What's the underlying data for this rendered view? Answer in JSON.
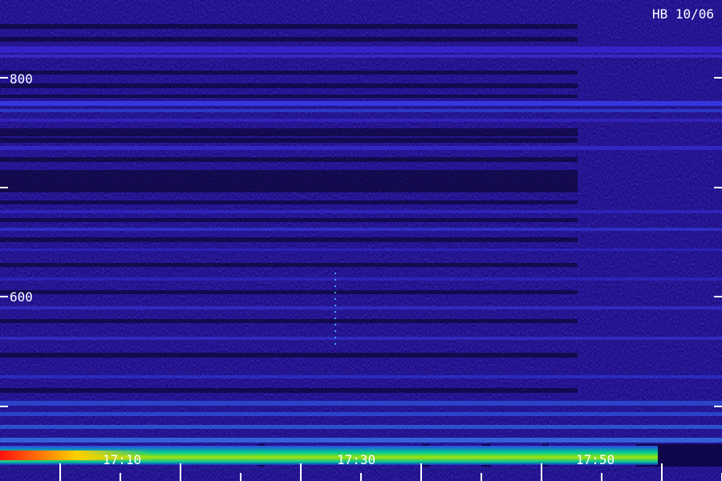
{
  "chart_data": {
    "type": "heatmap",
    "title": "HB 10/06",
    "xlabel": "",
    "ylabel": "",
    "x_tick_labels": [
      "17:10",
      "17:30",
      "17:50"
    ],
    "y_tick_labels": [
      "800",
      "600"
    ],
    "ylim": [
      450,
      860
    ],
    "colormap": [
      "#000000",
      "#1a0a7a",
      "#3a1ad8",
      "#2a6af0",
      "#00e08a",
      "#b8f000",
      "#ff2000"
    ],
    "background_color": "#1a0a7a",
    "label_color": "#ffffff",
    "grid": false
  }
}
